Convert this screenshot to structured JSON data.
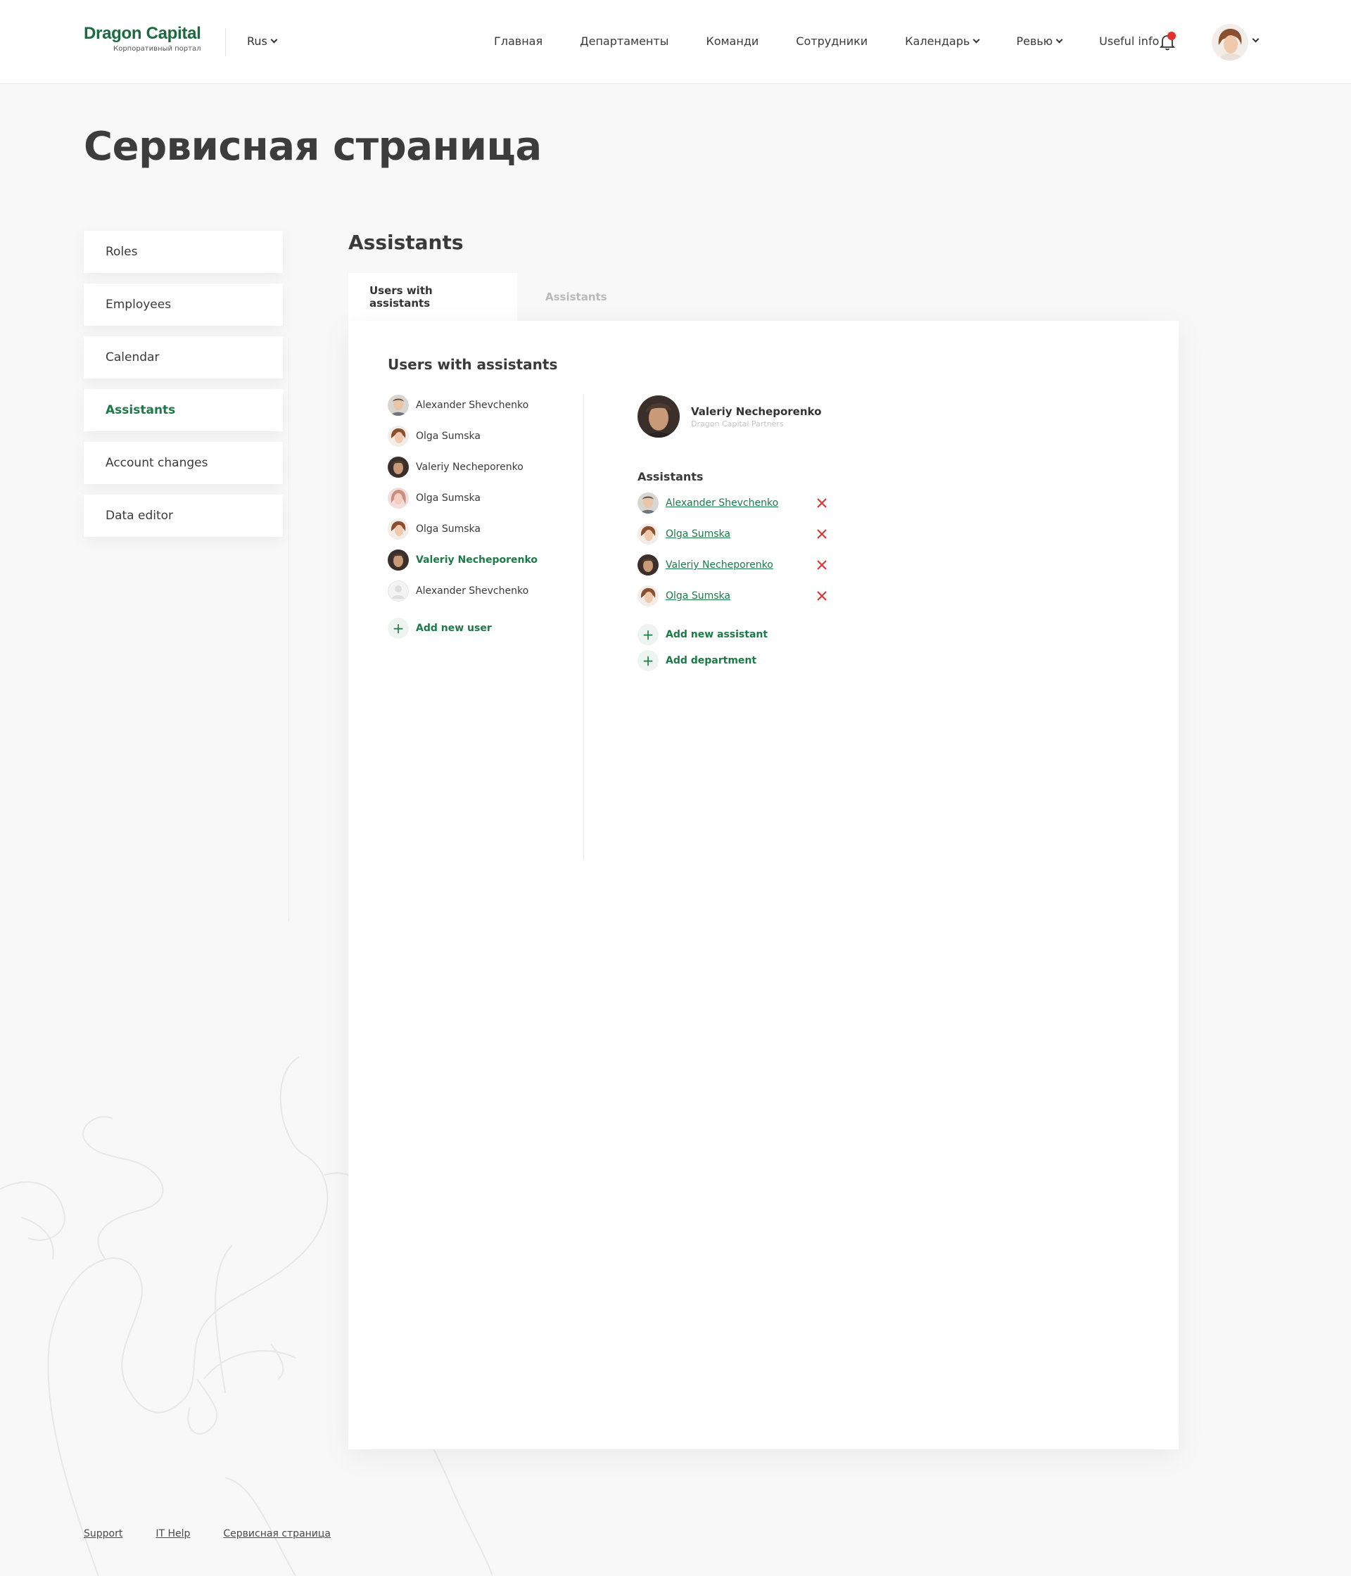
{
  "header": {
    "logo_text": "Dragon Capital",
    "logo_subtitle": "Корпоративный портал",
    "language": "Rus",
    "nav": [
      {
        "label": "Главная",
        "dropdown": false
      },
      {
        "label": "Департаменты",
        "dropdown": false
      },
      {
        "label": "Команди",
        "dropdown": false
      },
      {
        "label": "Сотрудники",
        "dropdown": false
      },
      {
        "label": "Календарь",
        "dropdown": true
      },
      {
        "label": "Ревью",
        "dropdown": true
      },
      {
        "label": "Useful info",
        "dropdown": false
      }
    ],
    "has_notification": true
  },
  "page": {
    "title": "Сервисная страница"
  },
  "sidebar": {
    "items": [
      {
        "label": "Roles"
      },
      {
        "label": "Employees"
      },
      {
        "label": "Calendar"
      },
      {
        "label": "Assistants",
        "active": true
      },
      {
        "label": "Account changes"
      },
      {
        "label": "Data editor"
      }
    ]
  },
  "main": {
    "title": "Assistants",
    "tabs": [
      {
        "label": "Users with assistants",
        "active": true
      },
      {
        "label": "Assistants",
        "active": false
      }
    ],
    "panel_title": "Users with assistants",
    "users": [
      {
        "name": "Alexander Shevchenko"
      },
      {
        "name": "Olga Sumska"
      },
      {
        "name": "Valeriy Necheporenko"
      },
      {
        "name": "Olga Sumska"
      },
      {
        "name": "Olga Sumska"
      },
      {
        "name": "Valeriy Necheporenko",
        "active": true
      },
      {
        "name": "Alexander Shevchenko"
      }
    ],
    "add_user_label": "Add new user",
    "selected": {
      "name": "Valeriy Necheporenko",
      "company": "Dragon Capital Partners"
    },
    "assistants_heading": "Assistants",
    "assistants": [
      {
        "name": "Alexander Shevchenko"
      },
      {
        "name": "Olga Sumska"
      },
      {
        "name": "Valeriy Necheporenko"
      },
      {
        "name": "Olga Sumska"
      }
    ],
    "add_assistant_label": "Add new assistant",
    "add_department_label": "Add department"
  },
  "footer": {
    "links": [
      "Support",
      "IT Help",
      "Сервисная страница"
    ]
  },
  "colors": {
    "accent": "#1c7a47",
    "remove": "#e52e2e",
    "background": "#f8f8f8"
  }
}
